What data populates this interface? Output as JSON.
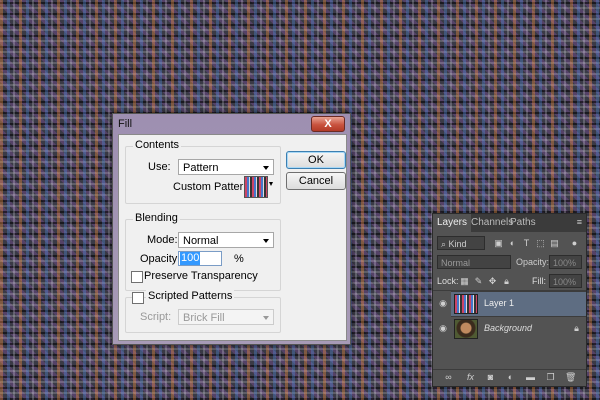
{
  "dialog": {
    "title": "Fill",
    "close_glyph": "X",
    "contents": {
      "legend": "Contents",
      "use_label": "Use:",
      "use_value": "Pattern",
      "custom_pattern_label": "Custom Pattern:"
    },
    "blending": {
      "legend": "Blending",
      "mode_label": "Mode:",
      "mode_value": "Normal",
      "opacity_label": "Opacity:",
      "opacity_value": "100",
      "opacity_unit": "%",
      "preserve_label": "Preserve Transparency",
      "preserve_checked": false
    },
    "scripted": {
      "label": "Scripted Patterns",
      "checked": false,
      "script_label": "Script:",
      "script_value": "Brick Fill"
    },
    "buttons": {
      "ok": "OK",
      "cancel": "Cancel"
    }
  },
  "layers_panel": {
    "tabs": [
      "Layers",
      "Channels",
      "Paths"
    ],
    "active_tab": "Layers",
    "filter_kind": "Kind",
    "blend_mode": "Normal",
    "opacity_label": "Opacity:",
    "opacity_value": "100%",
    "lock_label": "Lock:",
    "fill_label": "Fill:",
    "fill_value": "100%",
    "layers": [
      {
        "name": "Layer 1",
        "selected": true,
        "visible": true
      },
      {
        "name": "Background",
        "selected": false,
        "visible": true,
        "locked": true
      }
    ],
    "bottom_icons": [
      "link-icon",
      "fx-icon",
      "mask-icon",
      "adjustment-icon",
      "folder-icon",
      "new-layer-icon",
      "trash-icon"
    ]
  }
}
